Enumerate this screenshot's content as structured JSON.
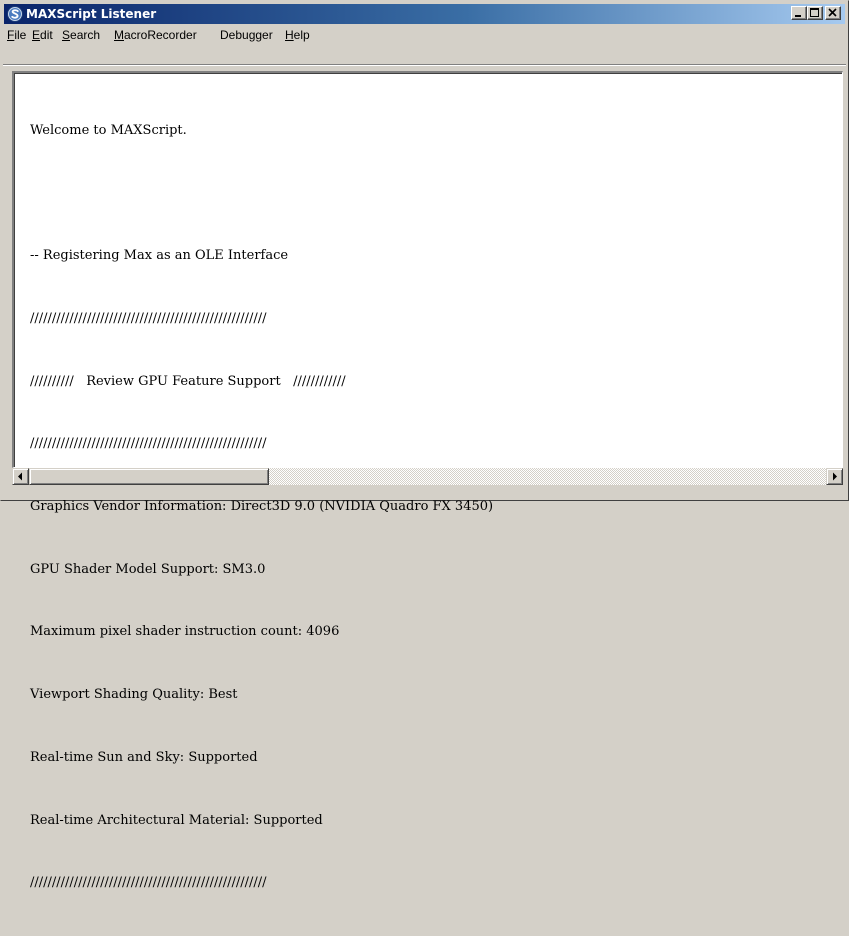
{
  "window": {
    "title": "MAXScript Listener",
    "app_icon": "maxscript-s-icon",
    "controls": [
      "minimize-icon",
      "maximize-icon",
      "close-icon"
    ]
  },
  "menubar": {
    "items": [
      {
        "label": "File",
        "mnemonic": "F"
      },
      {
        "label": "Edit",
        "mnemonic": "E"
      },
      {
        "label": "Search",
        "mnemonic": "S"
      },
      {
        "label": "MacroRecorder",
        "mnemonic": "M"
      },
      {
        "label": "Debugger",
        "mnemonic": ""
      },
      {
        "label": "Help",
        "mnemonic": "H"
      }
    ]
  },
  "console": {
    "lines": [
      "Welcome to MAXScript.",
      "",
      "-- Registering Max as an OLE Interface",
      "//////////////////////////////////////////////////////",
      "//////////   Review GPU Feature Support   ////////////",
      "//////////////////////////////////////////////////////",
      "Graphics Vendor Information: Direct3D 9.0 (NVIDIA Quadro FX 3450)",
      "GPU Shader Model Support: SM3.0",
      "Maximum pixel shader instruction count: 4096",
      "Viewport Shading Quality: Best",
      "Real-time Sun and Sky: Supported",
      "Real-time Architectural Material: Supported",
      "//////////////////////////////////////////////////////"
    ]
  },
  "colors": {
    "titlebar_start": "#0a246a",
    "titlebar_end": "#a6caf0",
    "chrome": "#d4d0c8",
    "console_bg": "#ffffff"
  },
  "scrollbar": {
    "left_arrow": "scroll-left-arrow-icon",
    "right_arrow": "scroll-right-arrow-icon"
  }
}
